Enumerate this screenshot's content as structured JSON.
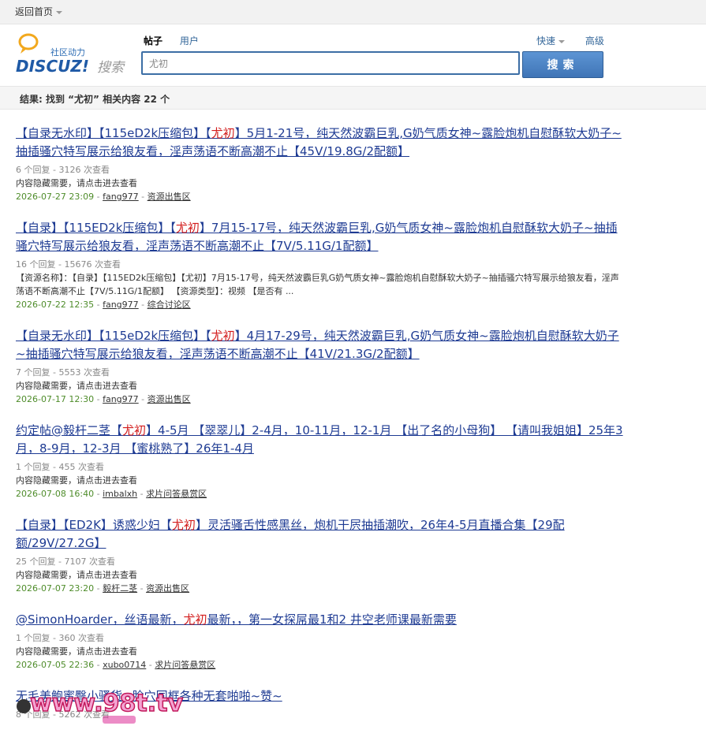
{
  "topbar": {
    "back_home": "返回首页"
  },
  "logo": {
    "top_text": "社区动力",
    "brand": "DISCUZ!",
    "search_word": "搜索"
  },
  "search": {
    "tabs": [
      "帖子",
      "用户"
    ],
    "quick_label": "快速",
    "advanced_label": "高级",
    "query": "尤初",
    "button_label": "搜索"
  },
  "summary": {
    "text": "结果: 找到 “尤初” 相关内容 22 个"
  },
  "results": [
    {
      "title_pre": "【自录无水印】【115eD2k压缩包】【",
      "title_hl": "尤初",
      "title_post": "】5月1-21号，纯天然波霸巨乳,G奶气质女神~露脸炮机自慰酥软大奶子~抽插骚穴特写展示给狼友看，淫声荡语不断高潮不止【45V/19.8G/2配额】",
      "stats": "6 个回复 - 3126 次查看",
      "desc": "内容隐藏需要，请点击进去查看",
      "date": "2026-07-27 23:09",
      "author": "fang977",
      "forum": "资源出售区"
    },
    {
      "title_pre": "【自录】【115ED2k压缩包】【",
      "title_hl": "尤初",
      "title_post": "】7月15-17号，纯天然波霸巨乳,G奶气质女神~露脸炮机自慰酥软大奶子~抽插骚穴特写展示给狼友看，淫声荡语不断高潮不止【7V/5.11G/1配额】",
      "stats": "16 个回复 - 15676 次查看",
      "desc": "【资源名称】：【自录】【115ED2k压缩包】【尤初】7月15-17号，纯天然波霸巨乳G奶气质女神~露脸炮机自慰酥软大奶子~抽插骚穴特写展示给狼友看，淫声荡语不断高潮不止【7V/5.11G/1配额】 【资源类型】：视频 【是否有 ...",
      "date": "2026-07-22 12:35",
      "author": "fang977",
      "forum": "综合讨论区"
    },
    {
      "title_pre": "【自录无水印】【115eD2k压缩包】【",
      "title_hl": "尤初",
      "title_post": "】4月17-29号，纯天然波霸巨乳,G奶气质女神~露脸炮机自慰酥软大奶子~抽插骚穴特写展示给狼友看，淫声荡语不断高潮不止【41V/21.3G/2配额】",
      "stats": "7 个回复 - 5553 次查看",
      "desc": "内容隐藏需要，请点击进去查看",
      "date": "2026-07-17 12:30",
      "author": "fang977",
      "forum": "资源出售区"
    },
    {
      "title_pre": "约定帖@毅杆二茎【",
      "title_hl": "尤初",
      "title_post": "】4-5月 【翠翠儿】2-4月，10-11月，12-1月 【出了名的小母狗】 【请叫我姐姐】25年3月，8-9月，12-3月 【蜜桃熟了】26年1-4月",
      "stats": "1 个回复 - 455 次查看",
      "desc": "内容隐藏需要，请点击进去查看",
      "date": "2026-07-08 16:40",
      "author": "imbalxh",
      "forum": "求片问答悬赏区"
    },
    {
      "title_pre": "【自录】【ED2K】诱惑少妇【",
      "title_hl": "尤初",
      "title_post": "】灵活骚舌性感黑丝，炮机干屄抽插潮吹，26年4-5月直播合集【29配额/29V/27.2G】",
      "stats": "25 个回复 - 7107 次查看",
      "desc": "内容隐藏需要，请点击进去查看",
      "date": "2026-07-07 23:20",
      "author": "毅杆二茎",
      "forum": "资源出售区"
    },
    {
      "title_pre": "@SimonHoarder，丝语最新，",
      "title_hl": "尤初",
      "title_post": "最新，，第一女探屌最1和2 井空老师课最新需要",
      "stats": "1 个回复 - 360 次查看",
      "desc": "内容隐藏需要，请点击进去查看",
      "date": "2026-07-05 22:36",
      "author": "xubo0714",
      "forum": "求片问答悬赏区"
    },
    {
      "title_pre": "",
      "title_hl": "",
      "title_post": "无毛美鲍蜜臀小骚货~脸穴同框各种无套啪啪~赞~",
      "stats": "8 个回复 - 5262 次查看",
      "desc": "",
      "date": "",
      "author": "",
      "forum": ""
    }
  ],
  "watermark": {
    "text": "www.98t.tv"
  }
}
